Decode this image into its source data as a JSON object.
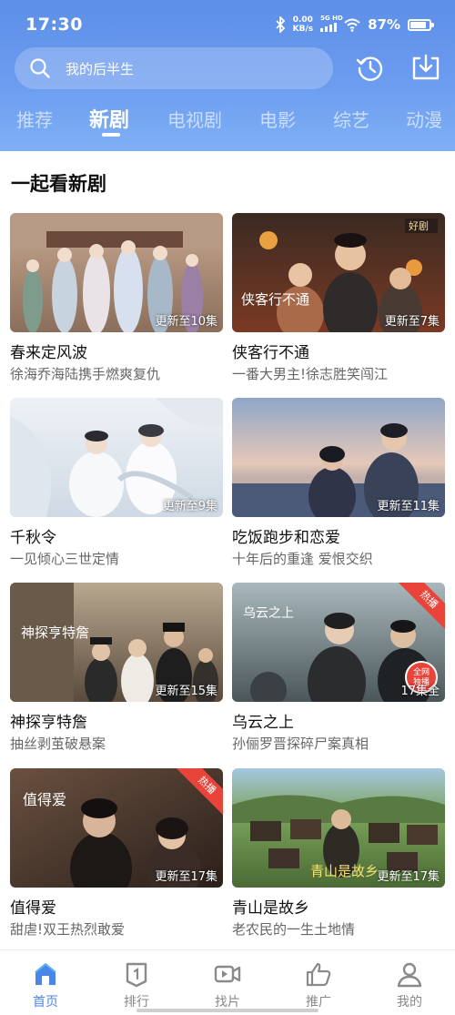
{
  "status_bar": {
    "time": "17:30",
    "net_speed_value": "0.00",
    "net_speed_unit": "KB/s",
    "signal_tag": "5G HD",
    "battery": "87%",
    "battery_level": 0.87,
    "icons": [
      "bluetooth-icon",
      "signal-icon",
      "wifi-icon",
      "battery-icon"
    ]
  },
  "search": {
    "placeholder": "我的后半生"
  },
  "header_actions": [
    "history-icon",
    "download-icon"
  ],
  "tabs": [
    {
      "label": "推荐",
      "active": false
    },
    {
      "label": "新剧",
      "active": true
    },
    {
      "label": "电视剧",
      "active": false
    },
    {
      "label": "电影",
      "active": false
    },
    {
      "label": "综艺",
      "active": false
    },
    {
      "label": "动漫",
      "active": false
    }
  ],
  "section": {
    "title": "一起看新剧"
  },
  "cards": [
    {
      "title": "春来定风波",
      "subtitle": "徐海乔海陆携手燃爽复仇",
      "episodes": "更新至10集"
    },
    {
      "title": "侠客行不通",
      "subtitle": "一番大男主!徐志胜笑闯江",
      "episodes": "更新至7集",
      "poster_text": "侠客行不通",
      "corner_text": "好剧"
    },
    {
      "title": "千秋令",
      "subtitle": "一见倾心三世定情",
      "episodes": "更新至9集"
    },
    {
      "title": "吃饭跑步和恋爱",
      "subtitle": "十年后的重逢 爱恨交织",
      "episodes": "更新至11集"
    },
    {
      "title": "神探亨特詹",
      "subtitle": "抽丝剥茧破悬案",
      "episodes": "更新至15集",
      "poster_text": "神探亨特詹"
    },
    {
      "title": "乌云之上",
      "subtitle": "孙俪罗晋探碎尸案真相",
      "episodes": "17集全",
      "hot": "热播",
      "badge_line1": "全网",
      "badge_line2": "独播",
      "poster_text": "乌云之上"
    },
    {
      "title": "值得爱",
      "subtitle": "甜虐!双王热烈敢爱",
      "episodes": "更新至17集",
      "hot": "热播",
      "poster_text": "值得爱"
    },
    {
      "title": "青山是故乡",
      "subtitle": "老农民的一生土地情",
      "episodes": "更新至17集",
      "poster_text": "青山是故乡"
    }
  ],
  "bottom_nav": [
    {
      "label": "首页",
      "icon": "home-icon",
      "active": true
    },
    {
      "label": "排行",
      "icon": "ranking-icon",
      "active": false
    },
    {
      "label": "找片",
      "icon": "video-camera-icon",
      "active": false
    },
    {
      "label": "推广",
      "icon": "thumbs-up-icon",
      "active": false
    },
    {
      "label": "我的",
      "icon": "user-icon",
      "active": false
    }
  ],
  "colors": {
    "accent": "#4a86e8",
    "header_top": "#5d8fe8",
    "header_bottom": "#7fb0f5",
    "hot_badge": "#e8443a"
  }
}
